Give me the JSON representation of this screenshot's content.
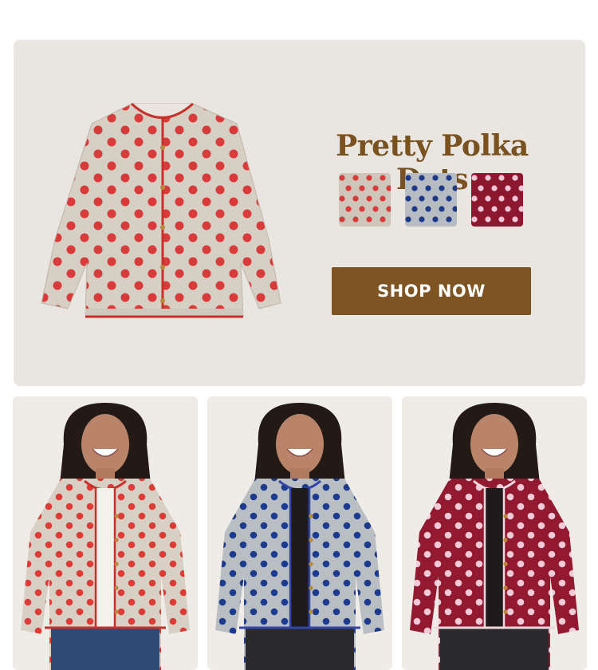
{
  "hero": {
    "title": "Pretty Polka Dots",
    "cta_label": "SHOP NOW",
    "swatches": [
      {
        "name": "beige-red",
        "base": "#cfc6bb",
        "dot": "#d93a3a"
      },
      {
        "name": "grey-navy",
        "base": "#b7bcc2",
        "dot": "#1d3a8a"
      },
      {
        "name": "burgundy-pink",
        "base": "#8c1830",
        "dot": "#f2c6d6"
      }
    ]
  },
  "colors": {
    "brand": "#7e5422",
    "title": "#7a5220",
    "panel": "#e9e6e2"
  },
  "models": [
    {
      "variant": "beige-red",
      "sweater": "#d8d0c5",
      "dot": "#df3b36",
      "trim": "#c9302c"
    },
    {
      "variant": "grey-navy",
      "sweater": "#b9bec3",
      "dot": "#1d3b8e",
      "trim": "#3345a8"
    },
    {
      "variant": "burgundy-pink",
      "sweater": "#92192f",
      "dot": "#f4c9d8",
      "trim": "#f0d8df"
    }
  ]
}
